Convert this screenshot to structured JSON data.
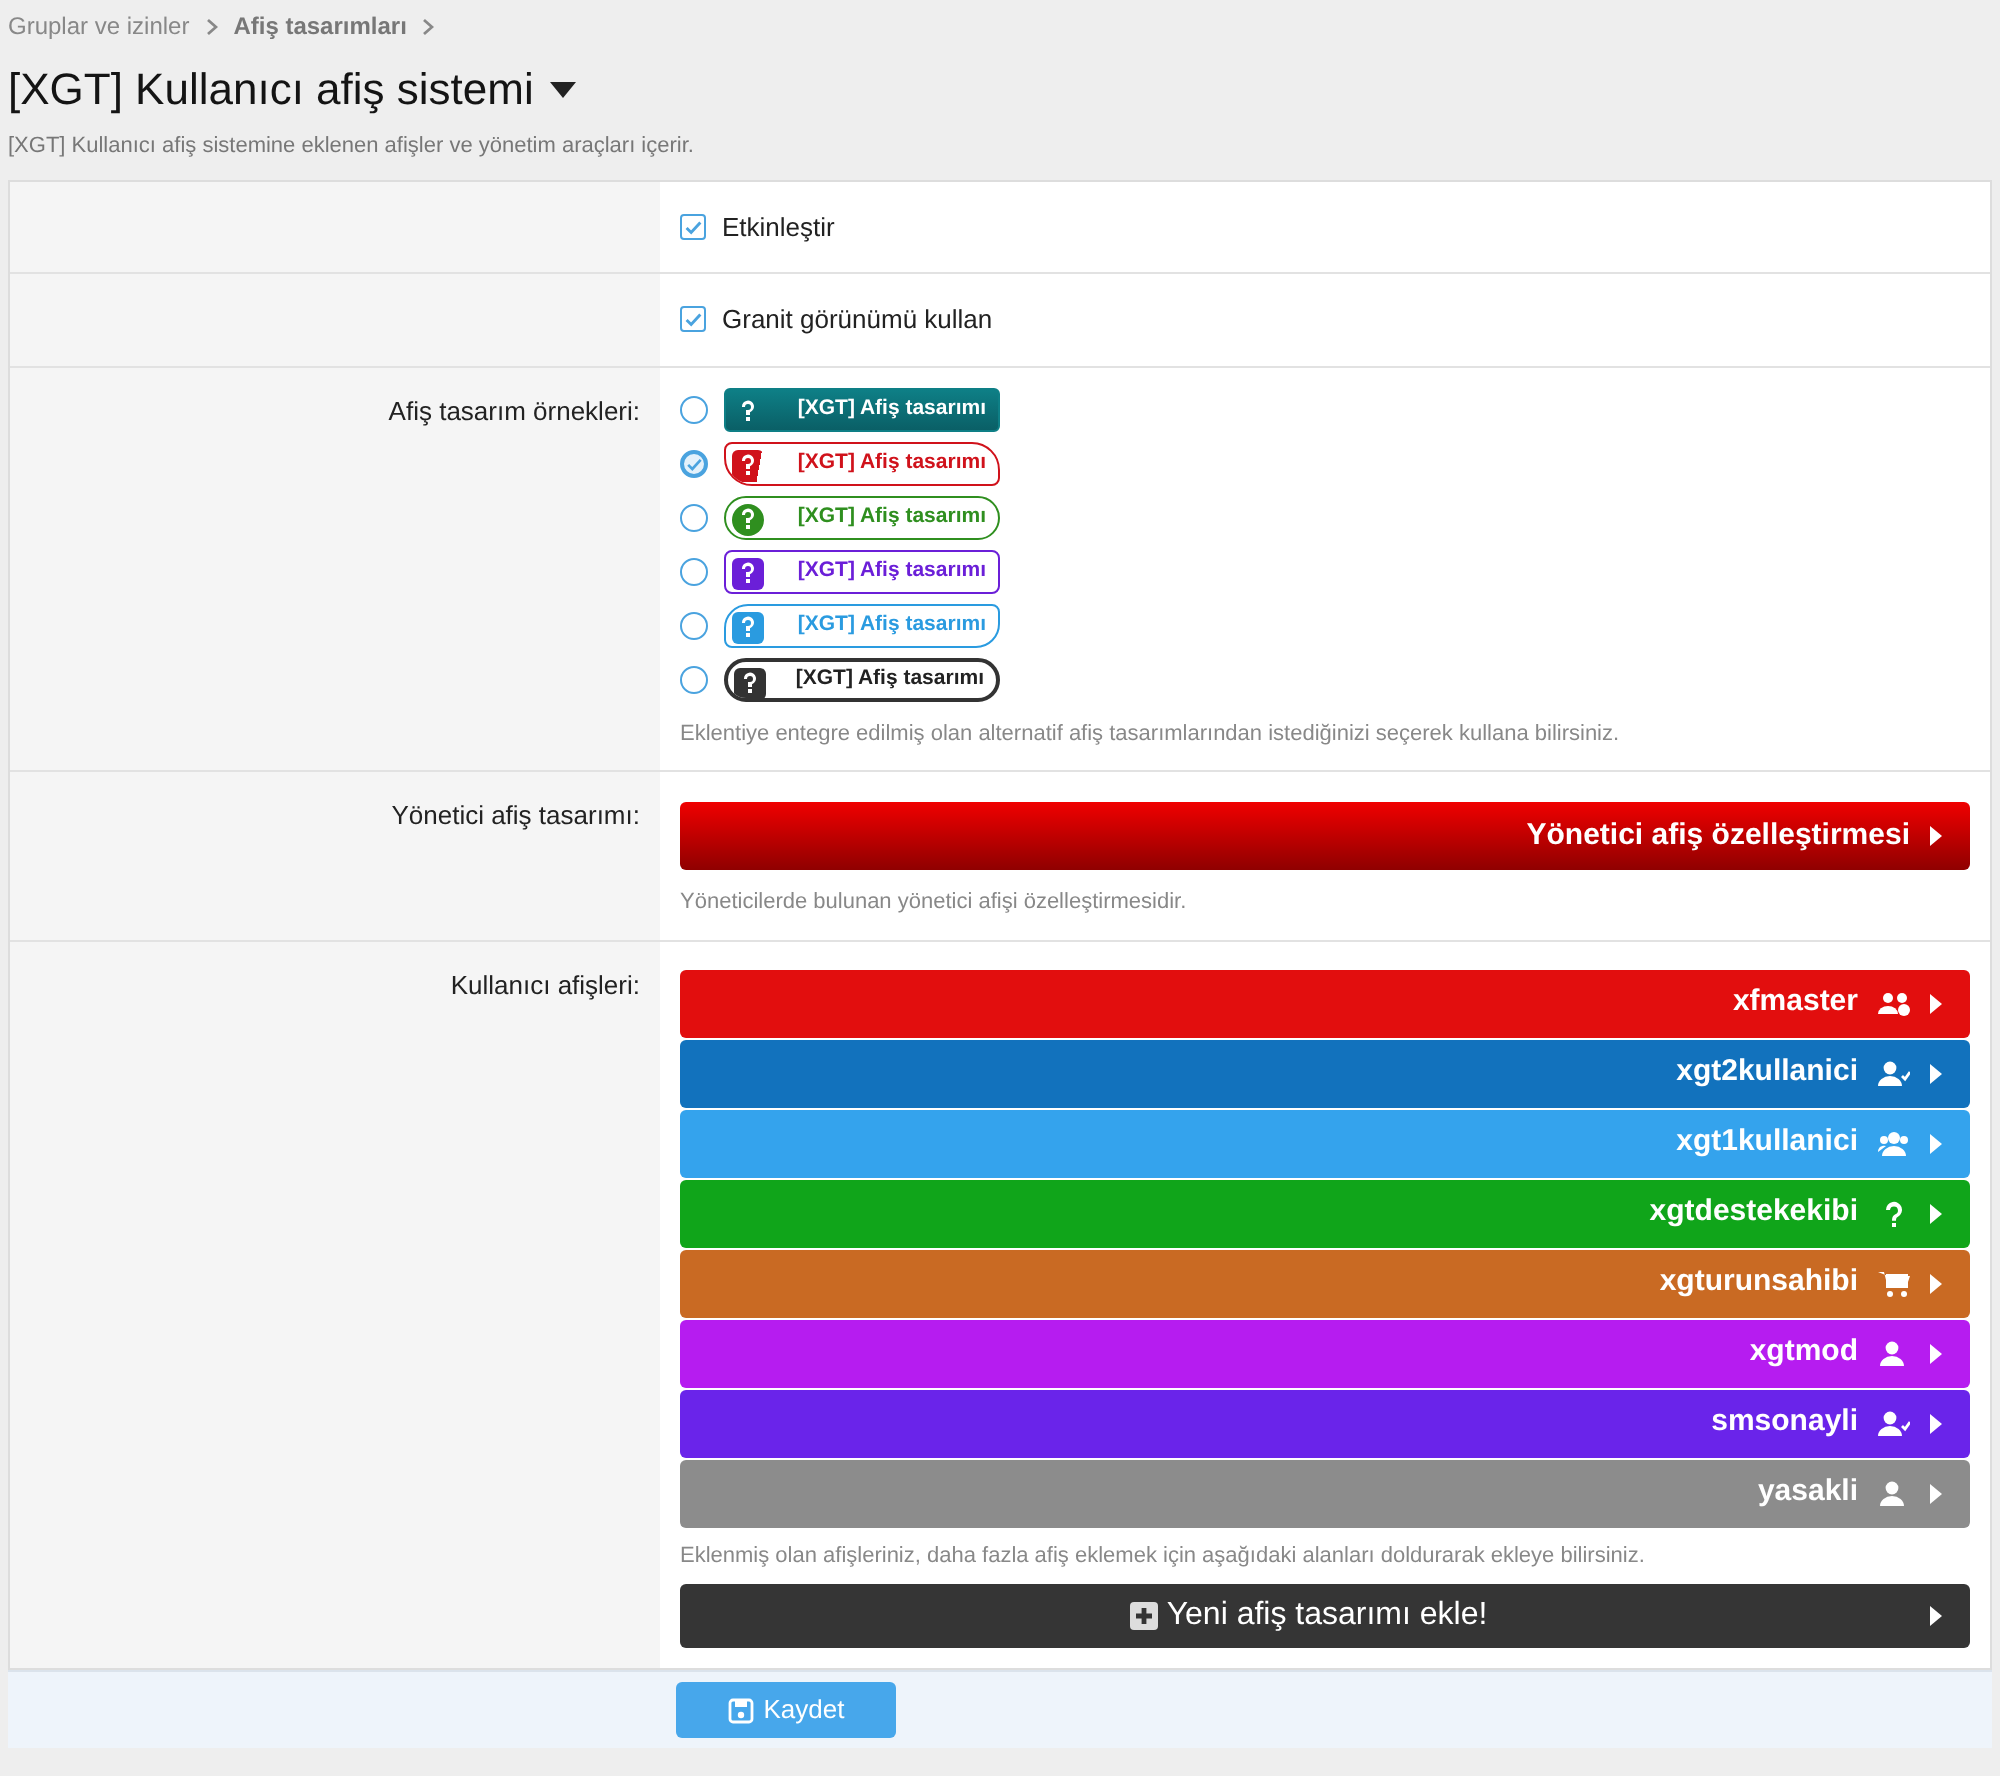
{
  "breadcrumb": [
    {
      "label": "Gruplar ve izinler",
      "current": false
    },
    {
      "label": "Afiş tasarımları",
      "current": true
    }
  ],
  "title": "[XGT] Kullanıcı afiş sistemi",
  "description": "[XGT] Kullanıcı afiş sistemine eklenen afişler ve yönetim araçları içerir.",
  "options": [
    {
      "label": "Etkinleştir",
      "checked": true
    },
    {
      "label": "Granit görünümü kullan",
      "checked": true
    }
  ],
  "designs": {
    "label": "Afiş tasarım örnekleri:",
    "items": [
      {
        "kind": "solid",
        "color": "#0e7f86",
        "text": "[XGT] Afiş tasarımı",
        "selected": false
      },
      {
        "kind": "ribbon",
        "color": "#d0121b",
        "text": "[XGT] Afiş tasarımı",
        "selected": true
      },
      {
        "kind": "pill",
        "color": "#2f8f1f",
        "text": "[XGT] Afiş tasarımı",
        "selected": false
      },
      {
        "kind": "tab",
        "color": "#6b1fd8",
        "text": "[XGT] Afiş tasarımı",
        "selected": false
      },
      {
        "kind": "slant",
        "color": "#2a9be0",
        "text": "[XGT] Afiş tasarımı",
        "selected": false
      },
      {
        "kind": "pill-dark",
        "color": "#333333",
        "text": "[XGT] Afiş tasarımı",
        "selected": false
      }
    ],
    "hint": "Eklentiye entegre edilmiş olan alternatif afiş tasarımlarından istediğinizi seçerek kullana bilirsiniz."
  },
  "admin": {
    "label": "Yönetici afiş tasarımı:",
    "button": "Yönetici afiş özelleştirmesi",
    "hint": "Yöneticilerde bulunan yönetici afişi özelleştirmesidir."
  },
  "user_banners": {
    "label": "Kullanıcı afişleri:",
    "items": [
      {
        "name": "xfmaster",
        "color": "#e20e0e",
        "kind": "users-gear"
      },
      {
        "name": "xgt2kullanici",
        "color": "#1272bd",
        "kind": "user-check"
      },
      {
        "name": "xgt1kullanici",
        "color": "#34a3ed",
        "kind": "users"
      },
      {
        "name": "xgtdestekekibi",
        "color": "#10a51a",
        "kind": "question"
      },
      {
        "name": "xgturunsahibi",
        "color": "#c96a23",
        "kind": "cart"
      },
      {
        "name": "xgtmod",
        "color": "#b61cf0",
        "kind": "user"
      },
      {
        "name": "smsonayli",
        "color": "#6a24ea",
        "kind": "user-check"
      },
      {
        "name": "yasakli",
        "color": "#8c8c8c",
        "kind": "user"
      }
    ],
    "hint": "Eklenmiş olan afişleriniz, daha fazla afiş eklemek için aşağıdaki alanları doldurarak ekleye bilirsiniz.",
    "add_button": "Yeni afiş tasarımı ekle!"
  },
  "save_button": "Kaydet"
}
